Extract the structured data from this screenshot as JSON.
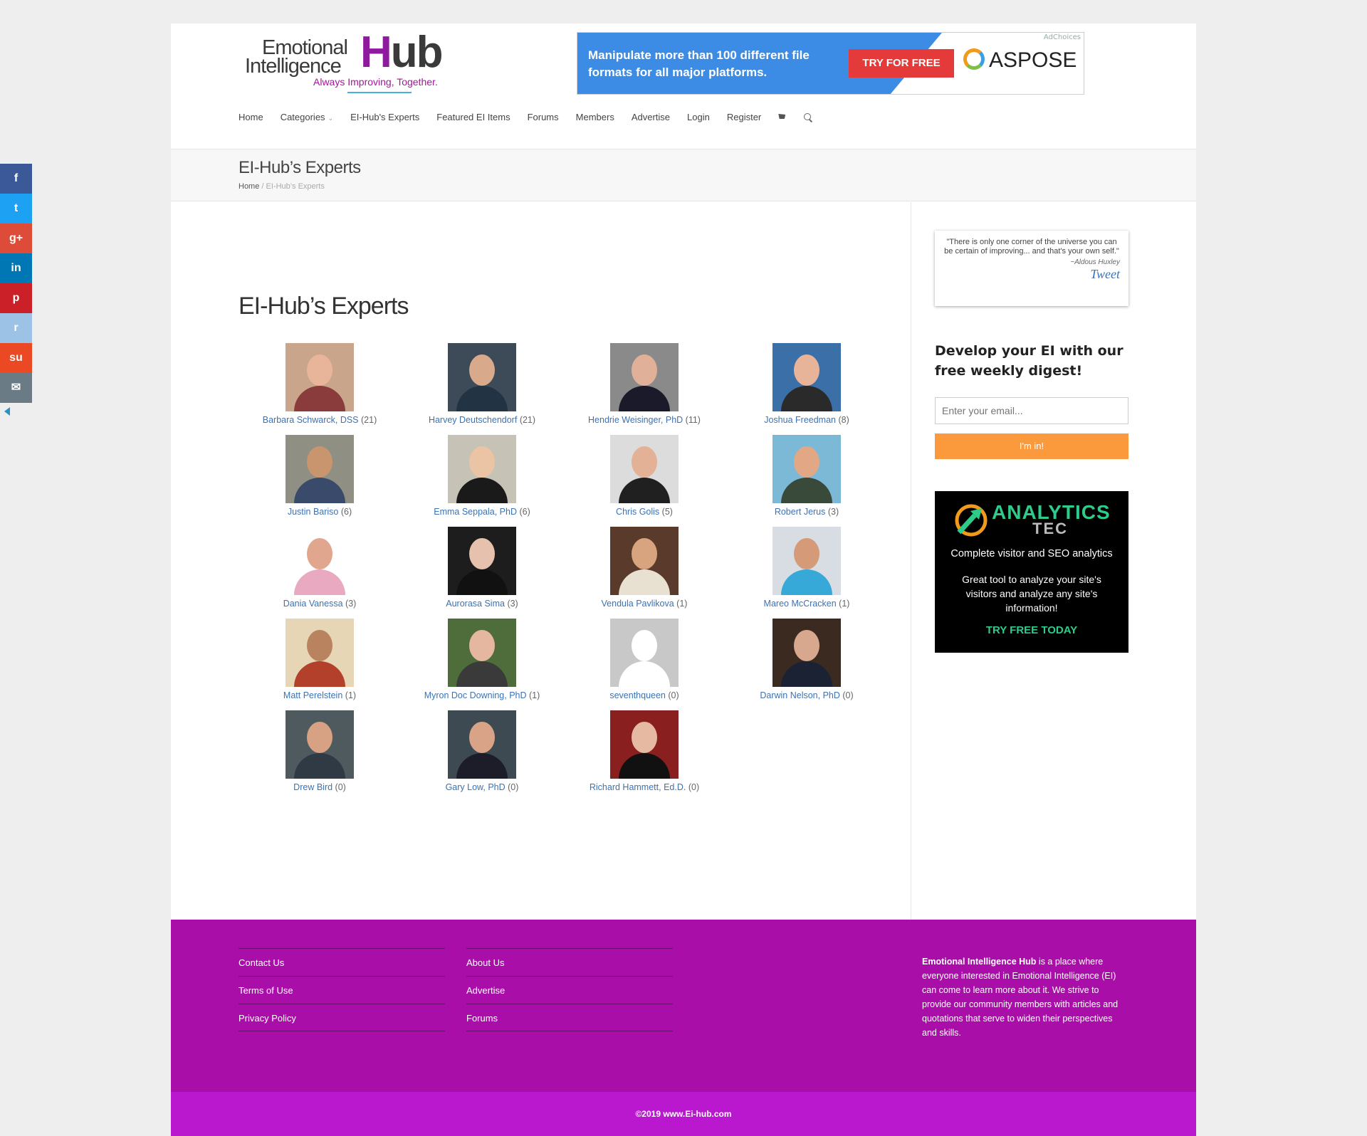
{
  "logo": {
    "line1": "Emotional",
    "line2": "Intelligence",
    "hub_h": "H",
    "hub_rest": "ub",
    "tagline": "Always Improving, Together."
  },
  "ad": {
    "text": "Manipulate more than 100 different file formats for all major platforms.",
    "button": "TRY FOR FREE",
    "brand": "ASPOSE",
    "choices": "AdChoices"
  },
  "nav": {
    "items": [
      "Home",
      "Categories",
      "EI-Hub's Experts",
      "Featured EI Items",
      "Forums",
      "Members",
      "Advertise",
      "Login",
      "Register"
    ]
  },
  "page": {
    "title": "EI-Hub’s Experts",
    "breadcrumb_home": "Home",
    "breadcrumb_sep": "/",
    "breadcrumb_current": "EI-Hub’s Experts",
    "heading": "EI-Hub’s Experts"
  },
  "experts": [
    {
      "name": "Barbara Schwarck, DSS",
      "count": "(21)",
      "bg": "#c9a58c",
      "skin": "#e8b59a",
      "shirt": "#8a3c3c"
    },
    {
      "name": "Harvey Deutschendorf",
      "count": "(21)",
      "bg": "#3d4a58",
      "skin": "#d9a98c",
      "shirt": "#223344"
    },
    {
      "name": "Hendrie Weisinger, PhD",
      "count": "(11)",
      "bg": "#8a8a8a",
      "skin": "#e0b098",
      "shirt": "#1a1a2a"
    },
    {
      "name": "Joshua Freedman",
      "count": "(8)",
      "bg": "#3b6fa8",
      "skin": "#e7b499",
      "shirt": "#2a2a2a"
    },
    {
      "name": "Justin Bariso",
      "count": "(6)",
      "bg": "#8f8f84",
      "skin": "#c9956f",
      "shirt": "#3a4a6a"
    },
    {
      "name": "Emma Seppala, PhD",
      "count": "(6)",
      "bg": "#c6c2b6",
      "skin": "#eac4a4",
      "shirt": "#1a1a1a"
    },
    {
      "name": "Chris Golis",
      "count": "(5)",
      "bg": "#dcdcdc",
      "skin": "#e3b196",
      "shirt": "#202020"
    },
    {
      "name": "Robert Jerus",
      "count": "(3)",
      "bg": "#7bb9d6",
      "skin": "#e2a886",
      "shirt": "#3a4a3a"
    },
    {
      "name": "Dania Vanessa",
      "count": "(3)",
      "bg": "#ffffff",
      "skin": "#e0a78e",
      "shirt": "#e9a9c0"
    },
    {
      "name": "Aurorasa Sima",
      "count": "(3)",
      "bg": "#1d1d1d",
      "skin": "#e6c2ae",
      "shirt": "#111111"
    },
    {
      "name": "Vendula Pavlikova",
      "count": "(1)",
      "bg": "#5a3a2a",
      "skin": "#d8a37f",
      "shirt": "#e8e0d0"
    },
    {
      "name": "Mareo McCracken",
      "count": "(1)",
      "bg": "#d8dde3",
      "skin": "#d59a78",
      "shirt": "#36a9d9"
    },
    {
      "name": "Matt Perelstein",
      "count": "(1)",
      "bg": "#e6d6b6",
      "skin": "#b98360",
      "shirt": "#b3402a"
    },
    {
      "name": "Myron Doc Downing, PhD",
      "count": "(1)",
      "bg": "#4f6d3a",
      "skin": "#e5b6a0",
      "shirt": "#3a3a3a"
    },
    {
      "name": "seventhqueen",
      "count": "(0)",
      "bg": "#c8c8c8",
      "skin": "#ffffff",
      "shirt": "#ffffff"
    },
    {
      "name": "Darwin Nelson, PhD",
      "count": "(0)",
      "bg": "#3a2a20",
      "skin": "#d7a88e",
      "shirt": "#1a2233"
    },
    {
      "name": "Drew Bird",
      "count": "(0)",
      "bg": "#4f5a5e",
      "skin": "#d7a183",
      "shirt": "#2f3a45"
    },
    {
      "name": "Gary Low, PhD",
      "count": "(0)",
      "bg": "#3d4a52",
      "skin": "#d9a387",
      "shirt": "#1d1d2a"
    },
    {
      "name": "Richard Hammett, Ed.D.",
      "count": "(0)",
      "bg": "#8a1f1f",
      "skin": "#e6b9a2",
      "shirt": "#111111"
    }
  ],
  "sidebar": {
    "quote": "\"There is only one corner of the universe you can be certain of improving... and that's your own self.\"",
    "quote_author": "~Aldous Huxley",
    "tweet": "Tweet",
    "digest_title": "Develop your EI with our free weekly digest!",
    "email_placeholder": "Enter your email...",
    "submit": "I'm in!",
    "ad": {
      "brand": "ANALYTICS",
      "sub": "TEC",
      "line1": "Complete visitor and SEO analytics",
      "line2": "Great tool to analyze your site's visitors and analyze any site's information!",
      "cta": "TRY FREE TODAY"
    }
  },
  "footer": {
    "col1": [
      "Contact Us",
      "Terms of Use",
      "Privacy Policy"
    ],
    "col2": [
      "About Us",
      "Advertise",
      "Forums"
    ],
    "about_bold": "Emotional Intelligence Hub",
    "about_rest": " is a place where everyone interested in Emotional Intelligence (EI) can come to learn more about it. We strive to provide our community members with articles and quotations that serve to widen their perspectives and skills.",
    "copyright": "©2019 www.Ei-hub.com"
  },
  "social": [
    {
      "icon": "facebook-icon",
      "glyph": "f",
      "color": "#3b5998"
    },
    {
      "icon": "twitter-icon",
      "glyph": "t",
      "color": "#1da1f2"
    },
    {
      "icon": "google-plus-icon",
      "glyph": "g+",
      "color": "#dd4b39"
    },
    {
      "icon": "linkedin-icon",
      "glyph": "in",
      "color": "#0077b5"
    },
    {
      "icon": "pinterest-icon",
      "glyph": "p",
      "color": "#cb2027"
    },
    {
      "icon": "reddit-icon",
      "glyph": "r",
      "color": "#9cc2e5"
    },
    {
      "icon": "stumbleupon-icon",
      "glyph": "su",
      "color": "#eb4924"
    },
    {
      "icon": "email-icon",
      "glyph": "✉",
      "color": "#6a7b85"
    }
  ]
}
